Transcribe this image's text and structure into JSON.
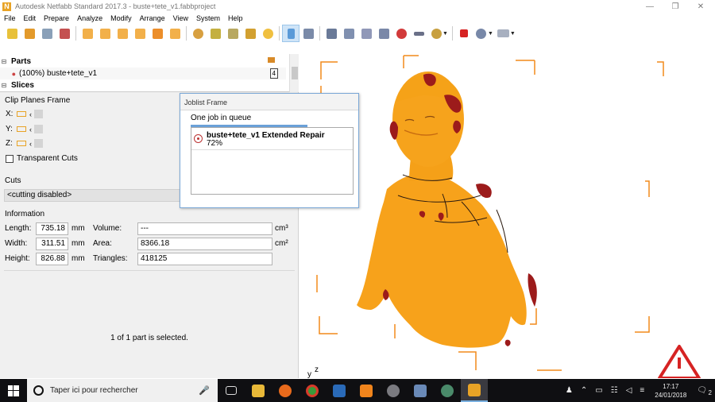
{
  "window": {
    "logo_letter": "N",
    "title": "Autodesk Netfabb Standard 2017.3 - buste+tete_v1.fabbproject",
    "minimize_glyph": "—",
    "maximize_glyph": "❐",
    "close_glyph": "✕"
  },
  "menu": [
    "File",
    "Edit",
    "Prepare",
    "Analyze",
    "Modify",
    "Arrange",
    "View",
    "System",
    "Help"
  ],
  "parts_tree": {
    "parts_label": "Parts",
    "part_label": "(100%) buste+tete_v1",
    "part_count": "4",
    "slices_label": "Slices"
  },
  "clip_planes": {
    "title": "Clip Planes Frame",
    "axes": [
      "X:",
      "Y:",
      "Z:"
    ],
    "transparent_cuts_label": "Transparent Cuts"
  },
  "cuts": {
    "title": "Cuts",
    "value": "<cutting disabled>"
  },
  "information": {
    "title": "Information",
    "length_label": "Length:",
    "length_value": "735.18",
    "width_label": "Width:",
    "width_value": "311.51",
    "height_label": "Height:",
    "height_value": "826.88",
    "unit_mm": "mm",
    "volume_label": "Volume:",
    "volume_value": "---",
    "volume_unit": "cm³",
    "area_label": "Area:",
    "area_value": "8366.18",
    "area_unit": "cm²",
    "triangles_label": "Triangles:",
    "triangles_value": "418125"
  },
  "selection_status": "1 of 1 part is selected.",
  "job_dialog": {
    "title": "Joblist Frame",
    "queue_text": "One job in queue",
    "job_name": "buste+tete_v1 Extended Repair",
    "job_progress": "72%"
  },
  "viewport": {
    "axis_y": "y",
    "axis_z": "z"
  },
  "taskbar": {
    "search_placeholder": "Taper ici pour rechercher",
    "time": "17:17",
    "date": "24/01/2018",
    "notification_count": "2"
  },
  "colors": {
    "model_orange": "#f7a21b",
    "defect_red": "#9c1b1b",
    "frame_orange": "#f28a1a",
    "warning_red": "#d62323"
  }
}
